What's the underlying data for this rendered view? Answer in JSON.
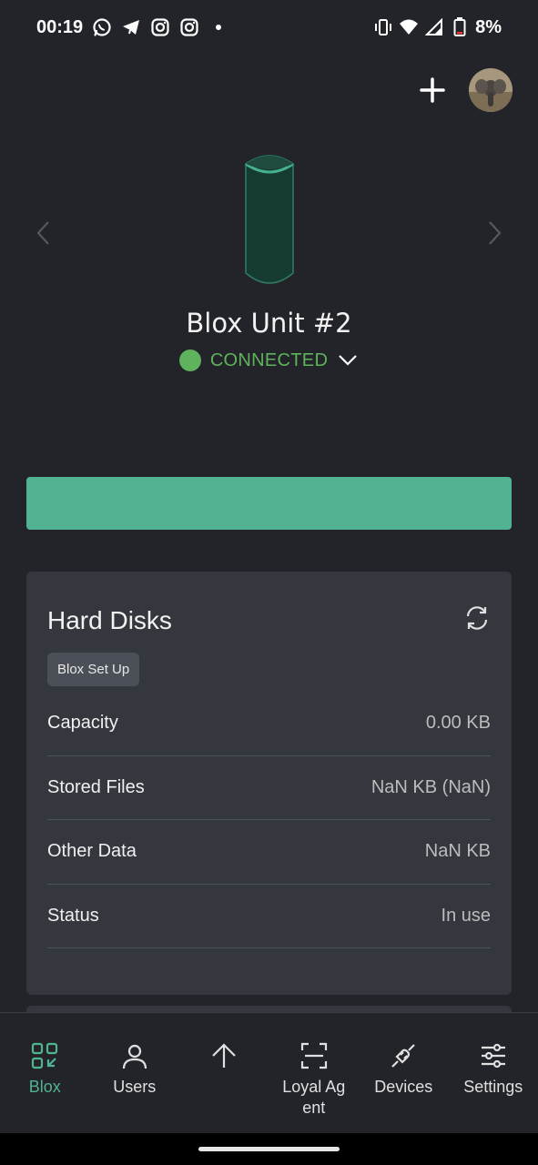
{
  "status_bar": {
    "time": "00:19",
    "left_icons": [
      "whatsapp-icon",
      "telegram-icon",
      "instagram-icon",
      "instagram-icon",
      "dot-icon"
    ],
    "right_icons": [
      "vibrate-icon",
      "wifi-icon",
      "signal-icon",
      "battery-icon"
    ],
    "battery": "8%"
  },
  "header": {
    "add_icon": "plus-icon",
    "avatar_icon": "elephant-avatar"
  },
  "device": {
    "name": "Blox Unit #2",
    "status": "CONNECTED",
    "status_color": "#5fb35c"
  },
  "banner": {
    "color": "#52b393"
  },
  "hard_disks": {
    "title": "Hard Disks",
    "chip": "Blox Set Up",
    "rows": [
      {
        "label": "Capacity",
        "value": "0.00 KB"
      },
      {
        "label": "Stored Files",
        "value": "NaN KB (NaN)"
      },
      {
        "label": "Other Data",
        "value": "NaN KB"
      },
      {
        "label": "Status",
        "value": "In use"
      }
    ]
  },
  "nav": {
    "items": [
      {
        "label": "Blox",
        "icon": "blox-icon",
        "active": true
      },
      {
        "label": "Users",
        "icon": "user-icon",
        "active": false
      },
      {
        "label": "",
        "icon": "upload-arrow-icon",
        "active": false
      },
      {
        "label": "Loyal Agent",
        "icon": "scan-icon",
        "active": false
      },
      {
        "label": "Devices",
        "icon": "plug-icon",
        "active": false
      },
      {
        "label": "Settings",
        "icon": "sliders-icon",
        "active": false
      }
    ]
  },
  "colors": {
    "background": "#222429",
    "card": "#34373d",
    "accent": "#52b393"
  }
}
